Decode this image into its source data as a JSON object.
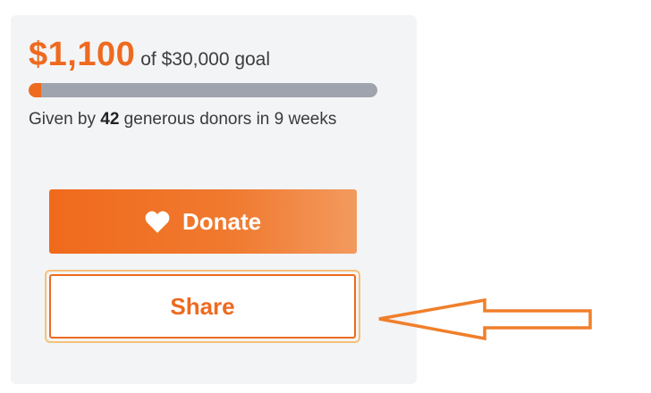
{
  "campaign": {
    "raised": "$1,100",
    "goal_text": "of $30,000 goal",
    "progress_fraction": 0.037,
    "donors_prefix": "Given by ",
    "donor_count": "42",
    "donors_suffix": " generous donors in 9 weeks"
  },
  "actions": {
    "donate_label": "Donate",
    "share_label": "Share"
  },
  "colors": {
    "accent": "#ee6a1f",
    "card_bg": "#f3f4f6",
    "track": "#9fa3ad",
    "focus_ring": "#f4c27a"
  },
  "icons": {
    "donate": "heart-icon",
    "annotation": "arrow-left-icon"
  }
}
